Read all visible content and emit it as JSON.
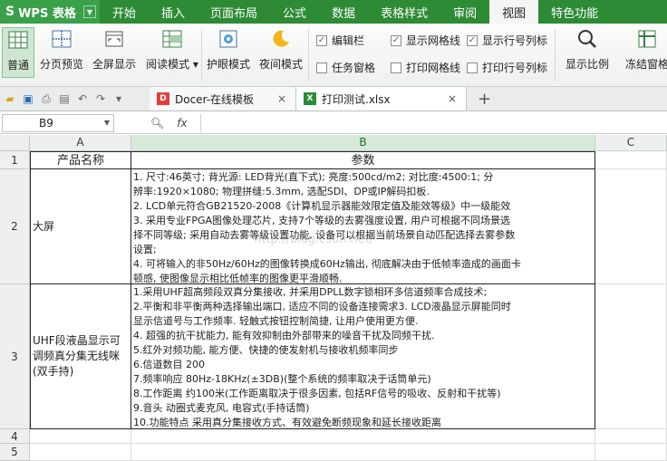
{
  "app": {
    "name": "WPS 表格",
    "logo": "S"
  },
  "menu": [
    "开始",
    "插入",
    "页面布局",
    "公式",
    "数据",
    "表格样式",
    "审阅",
    "视图",
    "特色功能"
  ],
  "menu_active": "视图",
  "ribbon": {
    "buttons": [
      "普通",
      "分页预览",
      "全屏显示",
      "阅读模式",
      "护眼模式",
      "夜间模式",
      "显示比例",
      "冻结窗格"
    ],
    "read_mode_arrow": "▾",
    "checks": {
      "edit_bar": "编辑栏",
      "task_pane": "任务窗格",
      "show_grid": "显示网格线",
      "print_grid": "打印网格线",
      "show_rowcol": "显示行号列标",
      "print_rowcol": "打印行号列标"
    }
  },
  "tabs": {
    "tab1": "Docer-在线模板",
    "tab2": "打印测试.xlsx",
    "close": "×",
    "add": "+"
  },
  "formula_bar": {
    "cell_ref": "B9",
    "fx": "fx",
    "value": ""
  },
  "columns": [
    "A",
    "B",
    "C"
  ],
  "rows": [
    "1",
    "2",
    "3",
    "4",
    "5"
  ],
  "table": {
    "header_a": "产品名称",
    "header_b": "参数",
    "row2_name": "大屏",
    "row2_lines": [
      "1. 尺寸:46英寸; 背光源: LED背光(直下式); 亮度:500cd/m2; 对比度:4500:1; 分",
      "辨率:1920×1080; 物理拼缝:5.3mm, 选配SDI、DP或IP解码扣板.",
      "2. LCD单元符合GB21520-2008《计算机显示器能效限定值及能效等级》中一级能效",
      "3. 采用专业FPGA图像处理芯片, 支持7个等级的去雾强度设置, 用户可根据不同场景选",
      "择不同等级; 采用自动去雾等级设置功能, 设备可以根据当前场景自动匹配选择去雾参数",
      "设置;",
      "4. 可将输入的非50Hz/60Hz的图像转换成60Hz输出, 彻底解决由于低帧率造成的画面卡",
      "顿感, 使图像显示相比低帧率的图像更平滑顺畅."
    ],
    "row3_name": "UHF段液晶显示可调频真分集无线咪(双手持)",
    "row3_lines": [
      "1.采用UHF超高频段双真分集接收, 并采用DPLL数字锁相环多信道频率合成技术;",
      "2.平衡和非平衡两种选择输出端口, 适应不同的设备连接需求3. LCD液晶显示屏能同时",
      "显示信道号与工作频率. 轻触式按钮控制简捷, 让用户使用更方便.",
      "4. 超强的抗干扰能力, 能有效抑制由外部带来的噪音干扰及同频干扰.",
      "5.红外对频功能, 能方便、快捷的使发射机与接收机频率同步",
      "6.信道数目 200",
      "7.频率响应 80Hz-18KHz(±3DB)(整个系统的频率取决于话筒单元)",
      "8.工作距离 约100米(工作距离取决于很多因素, 包括RF信号的吸收、反射和干扰等)",
      "9.音头 动圈式麦克风, 电容式(手持话筒)",
      "10.功能特点 采用真分集接收方式、有效避免断频现象和延长接收距离"
    ]
  },
  "watermark": "http://blog.csdn.net/",
  "colors": {
    "title_bg": "#2d8a35",
    "accent": "#3aa04a"
  }
}
